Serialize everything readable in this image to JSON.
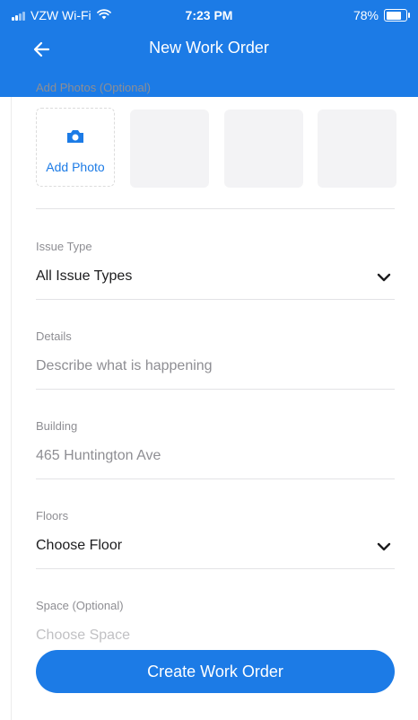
{
  "status_bar": {
    "carrier": "VZW Wi-Fi",
    "time": "7:23 PM",
    "battery": "78%",
    "battery_level": 0.78
  },
  "nav": {
    "title": "New Work Order",
    "back_icon": "arrow-left-icon"
  },
  "photos": {
    "label": "Add Photos (Optional)",
    "add_label": "Add Photo",
    "add_icon": "camera-icon",
    "empty_slots": 3
  },
  "form": {
    "issue_type": {
      "label": "Issue Type",
      "value": "All Issue Types",
      "icon": "chevron-down-icon"
    },
    "details": {
      "label": "Details",
      "placeholder": "Describe what is happening"
    },
    "building": {
      "label": "Building",
      "value": "465 Huntington Ave"
    },
    "floors": {
      "label": "Floors",
      "value": "Choose Floor",
      "icon": "chevron-down-icon"
    },
    "space": {
      "label": "Space (Optional)",
      "placeholder": "Choose Space"
    }
  },
  "actions": {
    "create_label": "Create Work Order"
  },
  "colors": {
    "primary": "#1c7be6",
    "label_gray": "#8e8e93",
    "divider": "#e3e3e6",
    "slot_bg": "#f3f3f5"
  }
}
